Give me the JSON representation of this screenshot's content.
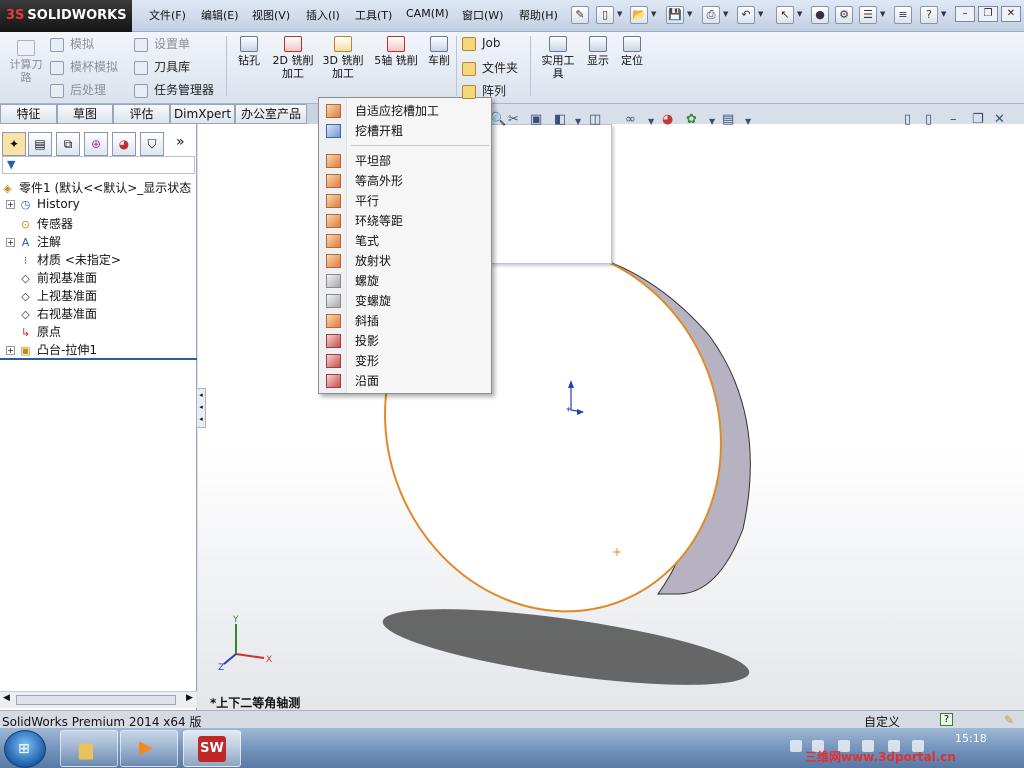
{
  "app": {
    "brand_prefix": "3S",
    "brand": "SOLIDWORKS"
  },
  "menu": [
    "文件(F)",
    "编辑(E)",
    "视图(V)",
    "插入(I)",
    "工具(T)",
    "CAM(M)",
    "窗口(W)",
    "帮助(H)"
  ],
  "ribbon": {
    "col1": {
      "label_line1": "计算刀",
      "label_line2": "路"
    },
    "small_left": [
      {
        "label": "模拟",
        "disabled": true
      },
      {
        "label": "模杯模拟",
        "disabled": true
      },
      {
        "label": "后处理",
        "disabled": true
      }
    ],
    "small_mid": [
      {
        "label": "设置单",
        "disabled": true
      },
      {
        "label": "刀具库",
        "disabled": false
      },
      {
        "label": "任务管理器",
        "disabled": false
      }
    ],
    "big": [
      {
        "line1": "钻孔",
        "line2": ""
      },
      {
        "line1": "2D 铣削",
        "line2": "加工"
      },
      {
        "line1": "3D 铣削",
        "line2": "加工"
      },
      {
        "line1": "5轴 铣削",
        "line2": ""
      },
      {
        "line1": "车削",
        "line2": ""
      }
    ],
    "files": [
      {
        "label": "Job"
      },
      {
        "label": "文件夹"
      },
      {
        "label": "阵列"
      }
    ],
    "right": [
      {
        "line1": "实用工",
        "line2": "具"
      },
      {
        "line1": "显示",
        "line2": ""
      },
      {
        "line1": "定位",
        "line2": ""
      }
    ]
  },
  "tabs": [
    "特征",
    "草图",
    "评估",
    "DimXpert",
    "办公室产品"
  ],
  "tree": {
    "root": "零件1 (默认<<默认>_显示状态",
    "items": [
      {
        "label": "History",
        "icon": "history-icon",
        "expandable": true
      },
      {
        "label": "传感器",
        "icon": "sensor-icon",
        "expandable": false
      },
      {
        "label": "注解",
        "icon": "annotation-icon",
        "expandable": true
      },
      {
        "label": "材质 <未指定>",
        "icon": "material-icon",
        "expandable": false
      },
      {
        "label": "前视基准面",
        "icon": "plane-icon",
        "expandable": false
      },
      {
        "label": "上视基准面",
        "icon": "plane-icon",
        "expandable": false
      },
      {
        "label": "右视基准面",
        "icon": "plane-icon",
        "expandable": false
      },
      {
        "label": "原点",
        "icon": "origin-icon",
        "expandable": false
      },
      {
        "label": "凸台-拉伸1",
        "icon": "extrude-icon",
        "expandable": true
      }
    ]
  },
  "dropdown": {
    "group1": [
      "自适应挖槽加工",
      "挖槽开粗"
    ],
    "group2": [
      "平坦部",
      "等高外形",
      "平行",
      "环绕等距",
      "笔式",
      "放射状",
      "螺旋",
      "变螺旋",
      "斜插",
      "投影",
      "变形",
      "沿面"
    ],
    "icon_tones": [
      "o",
      "b",
      "o",
      "o",
      "o",
      "o",
      "o",
      "o",
      "g",
      "g",
      "o",
      "r",
      "r",
      "r"
    ]
  },
  "viewport": {
    "view_label": "*上下二等角轴测",
    "triad": {
      "x": "X",
      "y": "Y",
      "z": "Z"
    }
  },
  "status": {
    "left": "SolidWorks Premium 2014 x64 版",
    "right": "自定义"
  },
  "taskbar": {
    "clock": "15:18",
    "watermark": "三维网www.3dportal.cn"
  },
  "colors": {
    "model_edge": "#e08a2a",
    "model_fill": "#ffffff",
    "model_side": "#b9b5c4",
    "shadow": "#2a2a2a"
  }
}
